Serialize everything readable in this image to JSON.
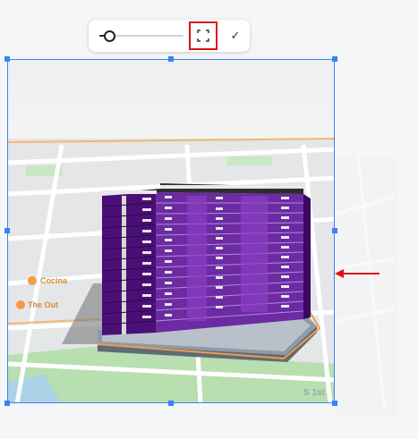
{
  "toolbar": {
    "zoom_value": 0.12,
    "fullscreen_label": "Fit to frame",
    "confirm_glyph": "✓"
  },
  "map_labels": {
    "label_1": "Cocina",
    "label_2": "The Out",
    "label_3": "S 1st"
  },
  "colors": {
    "selection": "#3b82f6",
    "highlight": "#dd1111",
    "building": "#5b1d8c",
    "building_light": "#8a3fc2"
  },
  "icons": [
    "expand-icon",
    "check-icon",
    "arrow-left-icon"
  ]
}
